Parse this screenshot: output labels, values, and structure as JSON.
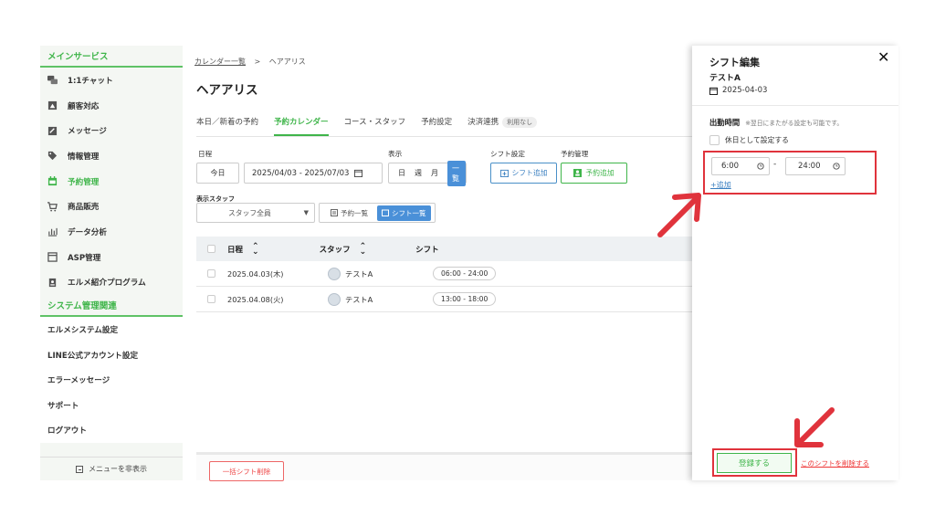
{
  "sidebar": {
    "main_section": "メインサービス",
    "main_items": [
      {
        "label": "1:1チャット",
        "icon": "chat-icon"
      },
      {
        "label": "顧客対応",
        "icon": "customer-icon"
      },
      {
        "label": "メッセージ",
        "icon": "message-icon"
      },
      {
        "label": "情報管理",
        "icon": "tag-icon"
      },
      {
        "label": "予約管理",
        "icon": "calendar-icon"
      },
      {
        "label": "商品販売",
        "icon": "cart-icon"
      },
      {
        "label": "データ分析",
        "icon": "chart-icon"
      },
      {
        "label": "ASP管理",
        "icon": "asp-icon"
      },
      {
        "label": "エルメ紹介プログラム",
        "icon": "referral-icon"
      }
    ],
    "system_section": "システム管理関連",
    "system_items": [
      "エルメシステム設定",
      "LINE公式アカウント設定",
      "エラーメッセージ",
      "サポート",
      "ログアウト"
    ],
    "hide_menu": "メニューを非表示"
  },
  "main": {
    "breadcrumb": {
      "parent": "カレンダー一覧",
      "separator": ">",
      "current": "ヘアアリス"
    },
    "title": "ヘアアリス",
    "tabs": [
      {
        "label": "本日／新着の予約"
      },
      {
        "label": "予約カレンダー"
      },
      {
        "label": "コース・スタッフ"
      },
      {
        "label": "予約設定"
      },
      {
        "label": "決済連携",
        "tag": "利用なし"
      }
    ],
    "labels": {
      "schedule": "日程",
      "display": "表示",
      "shift_settings": "シフト設定",
      "reservation_mgmt": "予約管理",
      "display_staff": "表示スタッフ"
    },
    "today_button": "今日",
    "date_range": "2025/04/03 - 2025/07/03",
    "view_options": {
      "day": "日",
      "week": "週",
      "month": "月",
      "list": "一覧"
    },
    "add_shift_button": "シフト追加",
    "add_reservation_button": "予約追加",
    "staff_select": "スタッフ全員",
    "list_toggle": {
      "reservations": "予約一覧",
      "shifts": "シフト一覧"
    },
    "table": {
      "headers": [
        "日程",
        "スタッフ",
        "シフト"
      ],
      "rows": [
        {
          "date": "2025.04.03(木)",
          "staff": "テストA",
          "shift": "06:00 - 24:00"
        },
        {
          "date": "2025.04.08(火)",
          "staff": "テストA",
          "shift": "13:00 - 18:00"
        }
      ]
    },
    "bulk_delete_button": "一括シフト削除"
  },
  "drawer": {
    "title": "シフト編集",
    "close": "✕",
    "staff_name": "テストA",
    "date": "2025-04-03",
    "work_hours_label": "出勤時間",
    "work_hours_note": "※翌日にまたがる設定も可能です。",
    "holiday_label": "休日として設定する",
    "start_time": "6:00",
    "time_separator": "-",
    "end_time": "24:00",
    "add_link": "+追加",
    "register_button": "登録する",
    "delete_link": "このシフトを削除する"
  },
  "colors": {
    "accent": "#3fb54a",
    "highlight": "#e0333c",
    "blue": "#4a90d8"
  }
}
